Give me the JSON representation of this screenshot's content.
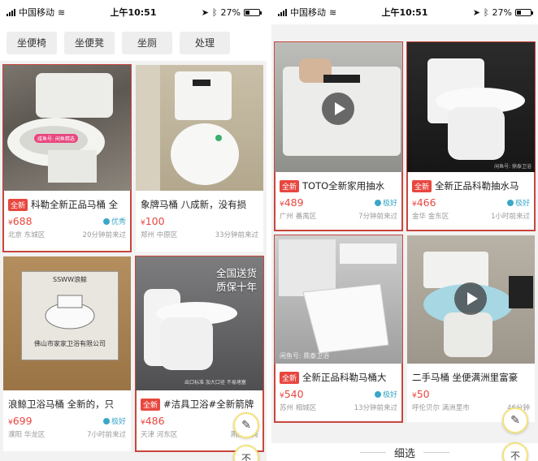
{
  "left_phone": {
    "status": {
      "carrier": "中国移动",
      "time": "上午10:51",
      "battery": "27%"
    },
    "chips": [
      "坐便椅",
      "坐便凳",
      "坐厕",
      "处理"
    ],
    "cards": [
      {
        "tag": "全新",
        "title": "科勒全新正品马桶 全",
        "price": "688",
        "condition": "优秀",
        "location": "北京 东城区",
        "time": "20分钟前来过",
        "highlight": true,
        "image_badge": "咸鱼号: 闲鱼精选"
      },
      {
        "tag": "",
        "title": "象牌马桶 八成新，没有损",
        "price": "100",
        "condition": "",
        "location": "郑州 中原区",
        "time": "33分钟前来过",
        "highlight": false
      },
      {
        "tag": "",
        "title": "浪鲸卫浴马桶 全新的，只",
        "price": "699",
        "condition": "极好",
        "location": "濮阳 华龙区",
        "time": "7小时前来过",
        "highlight": false,
        "box_brand": "SSWW浪鲸",
        "box_text": "佛山市家家卫浴有限公司"
      },
      {
        "tag": "全新",
        "title": "#洁具卫浴#全新箭牌",
        "price": "486",
        "condition": "",
        "location": "天津 河东区",
        "time": "刚刚擦亮",
        "highlight": true,
        "overlay": [
          "全国送货",
          "质保十年"
        ],
        "overlay_small": "出口标准 加大口径 不易堵塞"
      }
    ],
    "fab_icon": "edit-icon",
    "fab2_label": "不"
  },
  "right_phone": {
    "status": {
      "carrier": "中国移动",
      "time": "上午10:51",
      "battery": "27%"
    },
    "cards": [
      {
        "tag": "全新",
        "title": "TOTO全新家用抽水",
        "price": "489",
        "condition": "极好",
        "location": "广州 番禺区",
        "time": "7分钟前来过",
        "highlight": true,
        "video": true
      },
      {
        "tag": "全新",
        "title": "全新正品科勒抽水马",
        "price": "466",
        "condition": "极好",
        "location": "金华 金东区",
        "time": "1小时前来过",
        "highlight": true,
        "watermark": "闲鱼号: 鼎泰卫浴"
      },
      {
        "tag": "全新",
        "title": "全新正品科勒马桶大",
        "price": "540",
        "condition": "极好",
        "location": "苏州 相城区",
        "time": "13分钟前来过",
        "highlight": true,
        "watermark": "闲鱼号: 鼎泰卫浴"
      },
      {
        "tag": "",
        "title": "二手马桶 坐便满洲里富豪",
        "price": "50",
        "condition": "",
        "location": "呼伦贝尔 满洲里市",
        "time": "46分钟",
        "highlight": false,
        "video": true
      }
    ],
    "filter_label": "细选",
    "fab_icon": "edit-icon",
    "fab2_label": "不"
  },
  "currency": "¥",
  "colors": {
    "accent": "#e8473f",
    "highlight_border": "#c8463e",
    "condition": "#3aa6c8"
  }
}
